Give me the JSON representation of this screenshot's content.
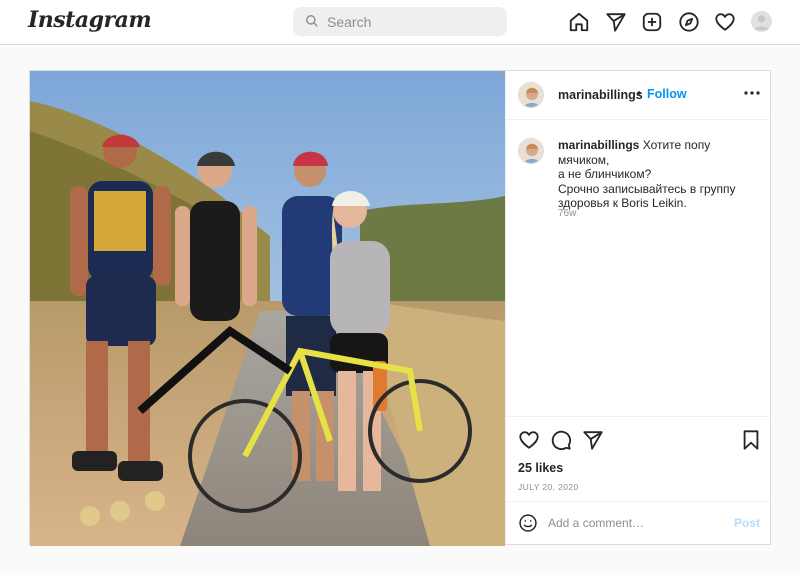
{
  "header": {
    "logo": "Instagram",
    "search_placeholder": "Search",
    "nav_icons": [
      "home-icon",
      "direct-icon",
      "new-post-icon",
      "explore-icon",
      "activity-icon",
      "profile-avatar"
    ]
  },
  "post": {
    "username": "marinabillings",
    "follow_label": "Follow",
    "separator": "•",
    "caption": {
      "username": "marinabillings",
      "line1": "Хотите попу мячиком,",
      "line2": "а не блинчиком?",
      "line3": "Срочно записывайтесь в группу",
      "line4": "здоровья к Boris Leikin."
    },
    "time_ago": "76w",
    "likes": "25 likes",
    "date": "JULY 20, 2020",
    "comment_placeholder": "Add a comment…",
    "post_label": "Post"
  },
  "colors": {
    "link_blue": "#0095f6",
    "post_disabled": "#b2dffc",
    "muted": "#8e8e8e",
    "border": "#dbdbdb"
  }
}
